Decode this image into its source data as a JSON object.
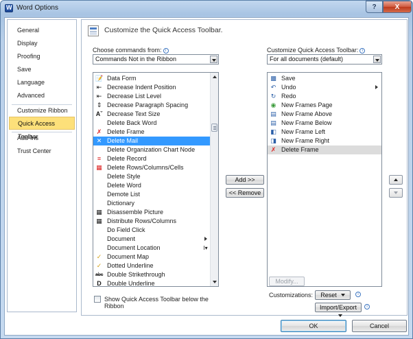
{
  "window": {
    "title": "Word Options",
    "help_label": "?",
    "close_label": "X"
  },
  "nav": {
    "items": [
      {
        "label": "General"
      },
      {
        "label": "Display"
      },
      {
        "label": "Proofing"
      },
      {
        "label": "Save"
      },
      {
        "label": "Language"
      },
      {
        "label": "Advanced"
      },
      {
        "label": "Customize Ribbon"
      },
      {
        "label": "Quick Access Toolbar",
        "active": true
      },
      {
        "label": "Add-Ins"
      },
      {
        "label": "Trust Center"
      }
    ]
  },
  "header": {
    "title": "Customize the Quick Access Toolbar.",
    "icon": "toolbar-customize-icon"
  },
  "choose_commands": {
    "label": "Choose commands from:",
    "selected": "Commands Not in the Ribbon"
  },
  "customize_toolbar": {
    "label": "Customize Quick Access Toolbar:",
    "selected": "For all documents (default)"
  },
  "commands_list": [
    {
      "label": "Data Form",
      "icon": "form-icon"
    },
    {
      "label": "Decrease Indent Position",
      "icon": "indent-icon"
    },
    {
      "label": "Decrease List Level",
      "icon": "list-level-icon"
    },
    {
      "label": "Decrease Paragraph Spacing",
      "icon": "spacing-icon"
    },
    {
      "label": "Decrease Text Size",
      "icon": "text-size-icon"
    },
    {
      "label": "Delete Back Word",
      "icon": ""
    },
    {
      "label": "Delete Frame",
      "icon": "delete-frame-icon"
    },
    {
      "label": "Delete Mail",
      "icon": "delete-x-icon",
      "selected": true
    },
    {
      "label": "Delete Organization Chart Node",
      "icon": ""
    },
    {
      "label": "Delete Record",
      "icon": "delete-record-icon"
    },
    {
      "label": "Delete Rows/Columns/Cells",
      "icon": "delete-cells-icon"
    },
    {
      "label": "Delete Style",
      "icon": ""
    },
    {
      "label": "Delete Word",
      "icon": ""
    },
    {
      "label": "Demote List",
      "icon": ""
    },
    {
      "label": "Dictionary",
      "icon": ""
    },
    {
      "label": "Disassemble Picture",
      "icon": "disassemble-icon"
    },
    {
      "label": "Distribute Rows/Columns",
      "icon": "distribute-icon"
    },
    {
      "label": "Do Field Click",
      "icon": ""
    },
    {
      "label": "Document",
      "icon": "",
      "submenu": true
    },
    {
      "label": "Document Location",
      "icon": "",
      "right_icon": "document-location-icon"
    },
    {
      "label": "Document Map",
      "icon": "checkmark-icon"
    },
    {
      "label": "Dotted Underline",
      "icon": "checkmark-icon"
    },
    {
      "label": "Double Strikethrough",
      "icon": "strikethrough-icon"
    },
    {
      "label": "Double Underline",
      "icon": "double-underline-icon"
    }
  ],
  "toolbar_list": [
    {
      "label": "Save",
      "icon": "save-icon"
    },
    {
      "label": "Undo",
      "icon": "undo-icon",
      "submenu": true
    },
    {
      "label": "Redo",
      "icon": "redo-icon"
    },
    {
      "label": "New Frames Page",
      "icon": "frames-page-icon"
    },
    {
      "label": "New Frame Above",
      "icon": "frame-above-icon"
    },
    {
      "label": "New Frame Below",
      "icon": "frame-below-icon"
    },
    {
      "label": "New Frame Left",
      "icon": "frame-left-icon"
    },
    {
      "label": "New Frame Right",
      "icon": "frame-right-icon"
    },
    {
      "label": "Delete Frame",
      "icon": "delete-frame-icon",
      "highlighted": true
    }
  ],
  "buttons": {
    "add": "Add >>",
    "remove": "<< Remove",
    "modify": "Modify...",
    "reset": "Reset",
    "import_export": "Import/Export",
    "ok": "OK",
    "cancel": "Cancel"
  },
  "customizations_label": "Customizations:",
  "show_below_ribbon": {
    "label_line1": "Show Quick Access Toolbar below the",
    "label_line2": "Ribbon",
    "checked": false
  },
  "colors": {
    "selection": "#3399ff",
    "active_nav": "#fde07a",
    "highlight_row": "#dcdcdc"
  }
}
